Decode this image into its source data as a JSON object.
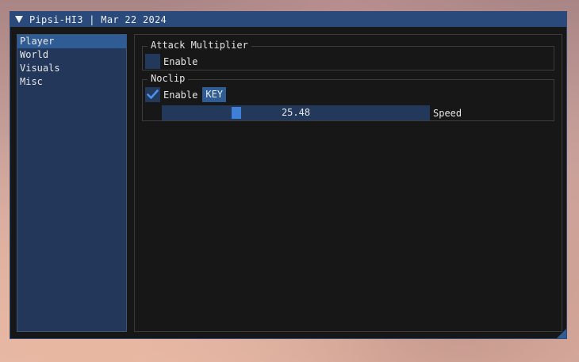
{
  "window": {
    "title": "Pipsi-HI3 | Mar 22 2024"
  },
  "sidebar": {
    "items": [
      {
        "label": "Player",
        "active": true
      },
      {
        "label": "World",
        "active": false
      },
      {
        "label": "Visuals",
        "active": false
      },
      {
        "label": "Misc",
        "active": false
      }
    ]
  },
  "sections": {
    "attack_multiplier": {
      "title": "Attack Multiplier",
      "enable_label": "Enable",
      "enabled": false
    },
    "noclip": {
      "title": "Noclip",
      "enable_label": "Enable",
      "enabled": true,
      "key_label": "KEY",
      "speed_value": "25.48",
      "speed_fraction": 0.27,
      "speed_label": "Speed"
    }
  },
  "colors": {
    "accent": "#2f5c95",
    "checkbox_bg": "#23395c",
    "checkmark": "#4c8ff0",
    "slider_thumb": "#3f7fd8"
  }
}
